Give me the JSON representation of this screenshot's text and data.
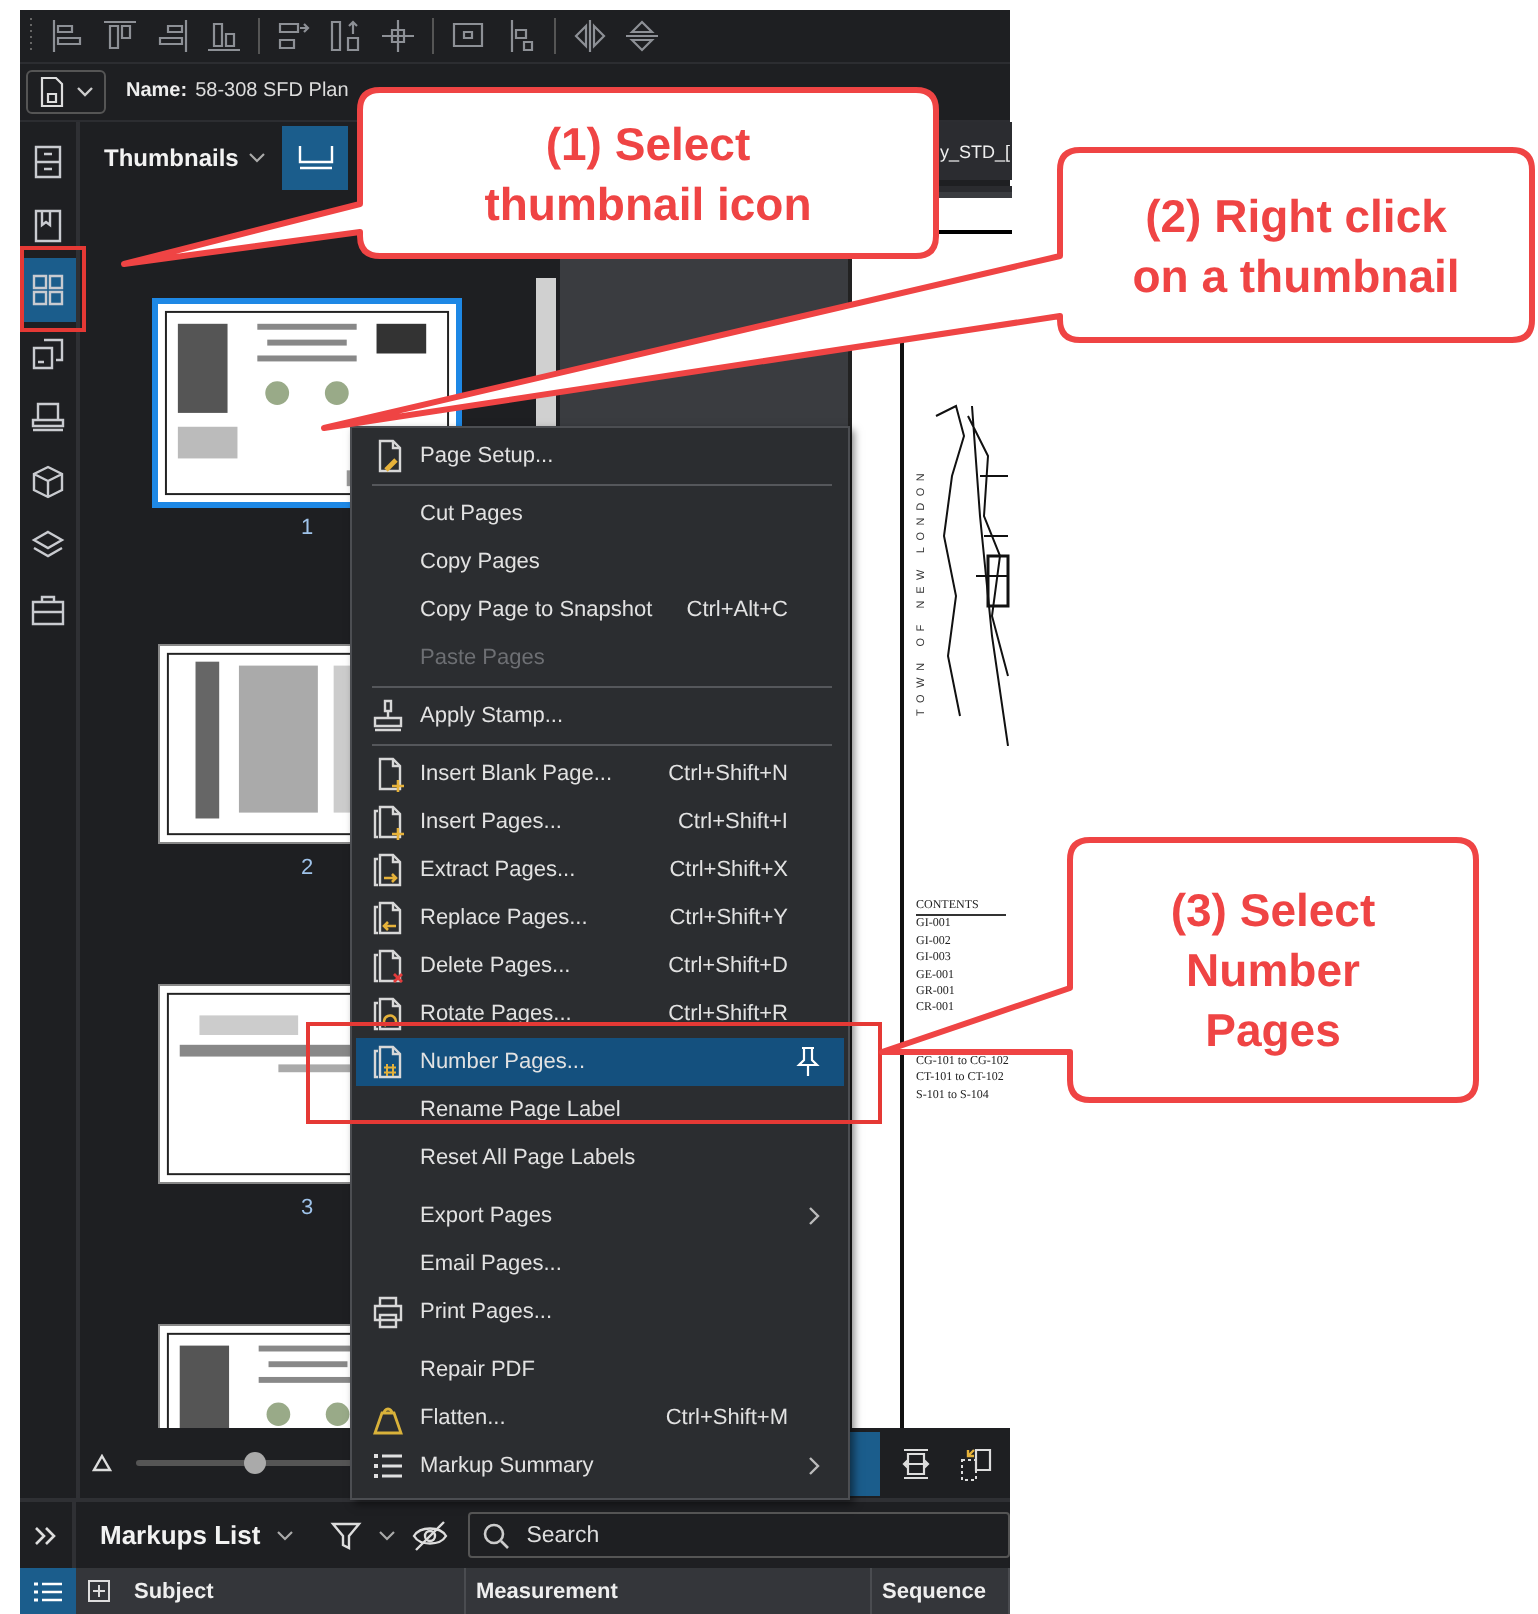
{
  "name_bar": {
    "label": "Name:",
    "value": "58-308 SFD Plan"
  },
  "left_rail": [
    {
      "selected": false
    },
    {
      "selected": false
    },
    {
      "selected": true
    },
    {
      "selected": false
    },
    {
      "selected": false
    },
    {
      "selected": false
    },
    {
      "selected": false
    },
    {
      "selected": false
    }
  ],
  "thumbnails_panel": {
    "title": "Thumbnails",
    "pages": [
      {
        "label": "1",
        "selected": true
      },
      {
        "label": "2",
        "selected": false
      },
      {
        "label": "3",
        "selected": false
      },
      {
        "selected": false
      }
    ],
    "zoom_slider": {
      "level": 0.33
    }
  },
  "document_tab": {
    "title": "y_STD_["
  },
  "document_page": {
    "side_text": "TOWN OF NEW LONDON",
    "contents_title": "CONTENTS",
    "contents": [
      "GI-001",
      "GI-002",
      "GI-003",
      "GE-001",
      "GR-001",
      "CR-001",
      "CG-101 to CG-102",
      "CT-101 to CT-102",
      "S-101 to S-104"
    ]
  },
  "document_toolbar": [
    {
      "selected": true
    },
    {
      "selected": false
    },
    {
      "selected": false
    }
  ],
  "context_menu": {
    "items": [
      {
        "kind": "item",
        "label": "Page Setup...",
        "disabled": false,
        "selected": false,
        "submenu": false
      },
      {
        "kind": "separator"
      },
      {
        "kind": "item",
        "label": "Cut Pages",
        "disabled": false,
        "selected": false,
        "submenu": false
      },
      {
        "kind": "item",
        "label": "Copy Pages",
        "disabled": false,
        "selected": false,
        "submenu": false
      },
      {
        "kind": "item",
        "label": "Copy Page to Snapshot",
        "shortcut": "Ctrl+Alt+C",
        "disabled": false,
        "selected": false,
        "submenu": false
      },
      {
        "kind": "item",
        "label": "Paste Pages",
        "disabled": true,
        "selected": false,
        "submenu": false
      },
      {
        "kind": "separator"
      },
      {
        "kind": "item",
        "label": "Apply Stamp...",
        "disabled": false,
        "selected": false,
        "submenu": false
      },
      {
        "kind": "separator"
      },
      {
        "kind": "item",
        "label": "Insert Blank Page...",
        "shortcut": "Ctrl+Shift+N",
        "disabled": false,
        "selected": false,
        "submenu": false
      },
      {
        "kind": "item",
        "label": "Insert Pages...",
        "shortcut": "Ctrl+Shift+I",
        "disabled": false,
        "selected": false,
        "submenu": false
      },
      {
        "kind": "item",
        "label": "Extract Pages...",
        "shortcut": "Ctrl+Shift+X",
        "disabled": false,
        "selected": false,
        "submenu": false
      },
      {
        "kind": "item",
        "label": "Replace Pages...",
        "shortcut": "Ctrl+Shift+Y",
        "disabled": false,
        "selected": false,
        "submenu": false
      },
      {
        "kind": "item",
        "label": "Delete Pages...",
        "shortcut": "Ctrl+Shift+D",
        "disabled": false,
        "selected": false,
        "submenu": false
      },
      {
        "kind": "item",
        "label": "Rotate Pages...",
        "shortcut": "Ctrl+Shift+R",
        "disabled": false,
        "selected": false,
        "submenu": false
      },
      {
        "kind": "item",
        "label": "Number Pages...",
        "disabled": false,
        "selected": true,
        "submenu": false
      },
      {
        "kind": "item",
        "label": "Rename Page Label",
        "disabled": false,
        "selected": false,
        "submenu": false
      },
      {
        "kind": "item",
        "label": "Reset All Page Labels",
        "disabled": false,
        "selected": false,
        "submenu": false
      },
      {
        "kind": "spacer"
      },
      {
        "kind": "item",
        "label": "Export Pages",
        "disabled": false,
        "selected": false,
        "submenu": true
      },
      {
        "kind": "item",
        "label": "Email Pages...",
        "disabled": false,
        "selected": false,
        "submenu": false
      },
      {
        "kind": "item",
        "label": "Print Pages...",
        "disabled": false,
        "selected": false,
        "submenu": false
      },
      {
        "kind": "spacer"
      },
      {
        "kind": "item",
        "label": "Repair PDF",
        "disabled": false,
        "selected": false,
        "submenu": false
      },
      {
        "kind": "item",
        "label": "Flatten...",
        "shortcut": "Ctrl+Shift+M",
        "disabled": false,
        "selected": false,
        "submenu": false
      },
      {
        "kind": "item",
        "label": "Markup Summary",
        "disabled": false,
        "selected": false,
        "submenu": true
      }
    ]
  },
  "markups_panel": {
    "title": "Markups List",
    "search": {
      "placeholder": "Search"
    },
    "columns": [
      "Subject",
      "Measurement",
      "Sequence"
    ]
  },
  "callouts": [
    {
      "lines": [
        "(1) Select",
        "thumbnail icon"
      ]
    },
    {
      "lines": [
        "(2) Right click",
        "on a thumbnail"
      ]
    },
    {
      "lines": [
        "(3) Select",
        "Number",
        "Pages"
      ]
    }
  ]
}
